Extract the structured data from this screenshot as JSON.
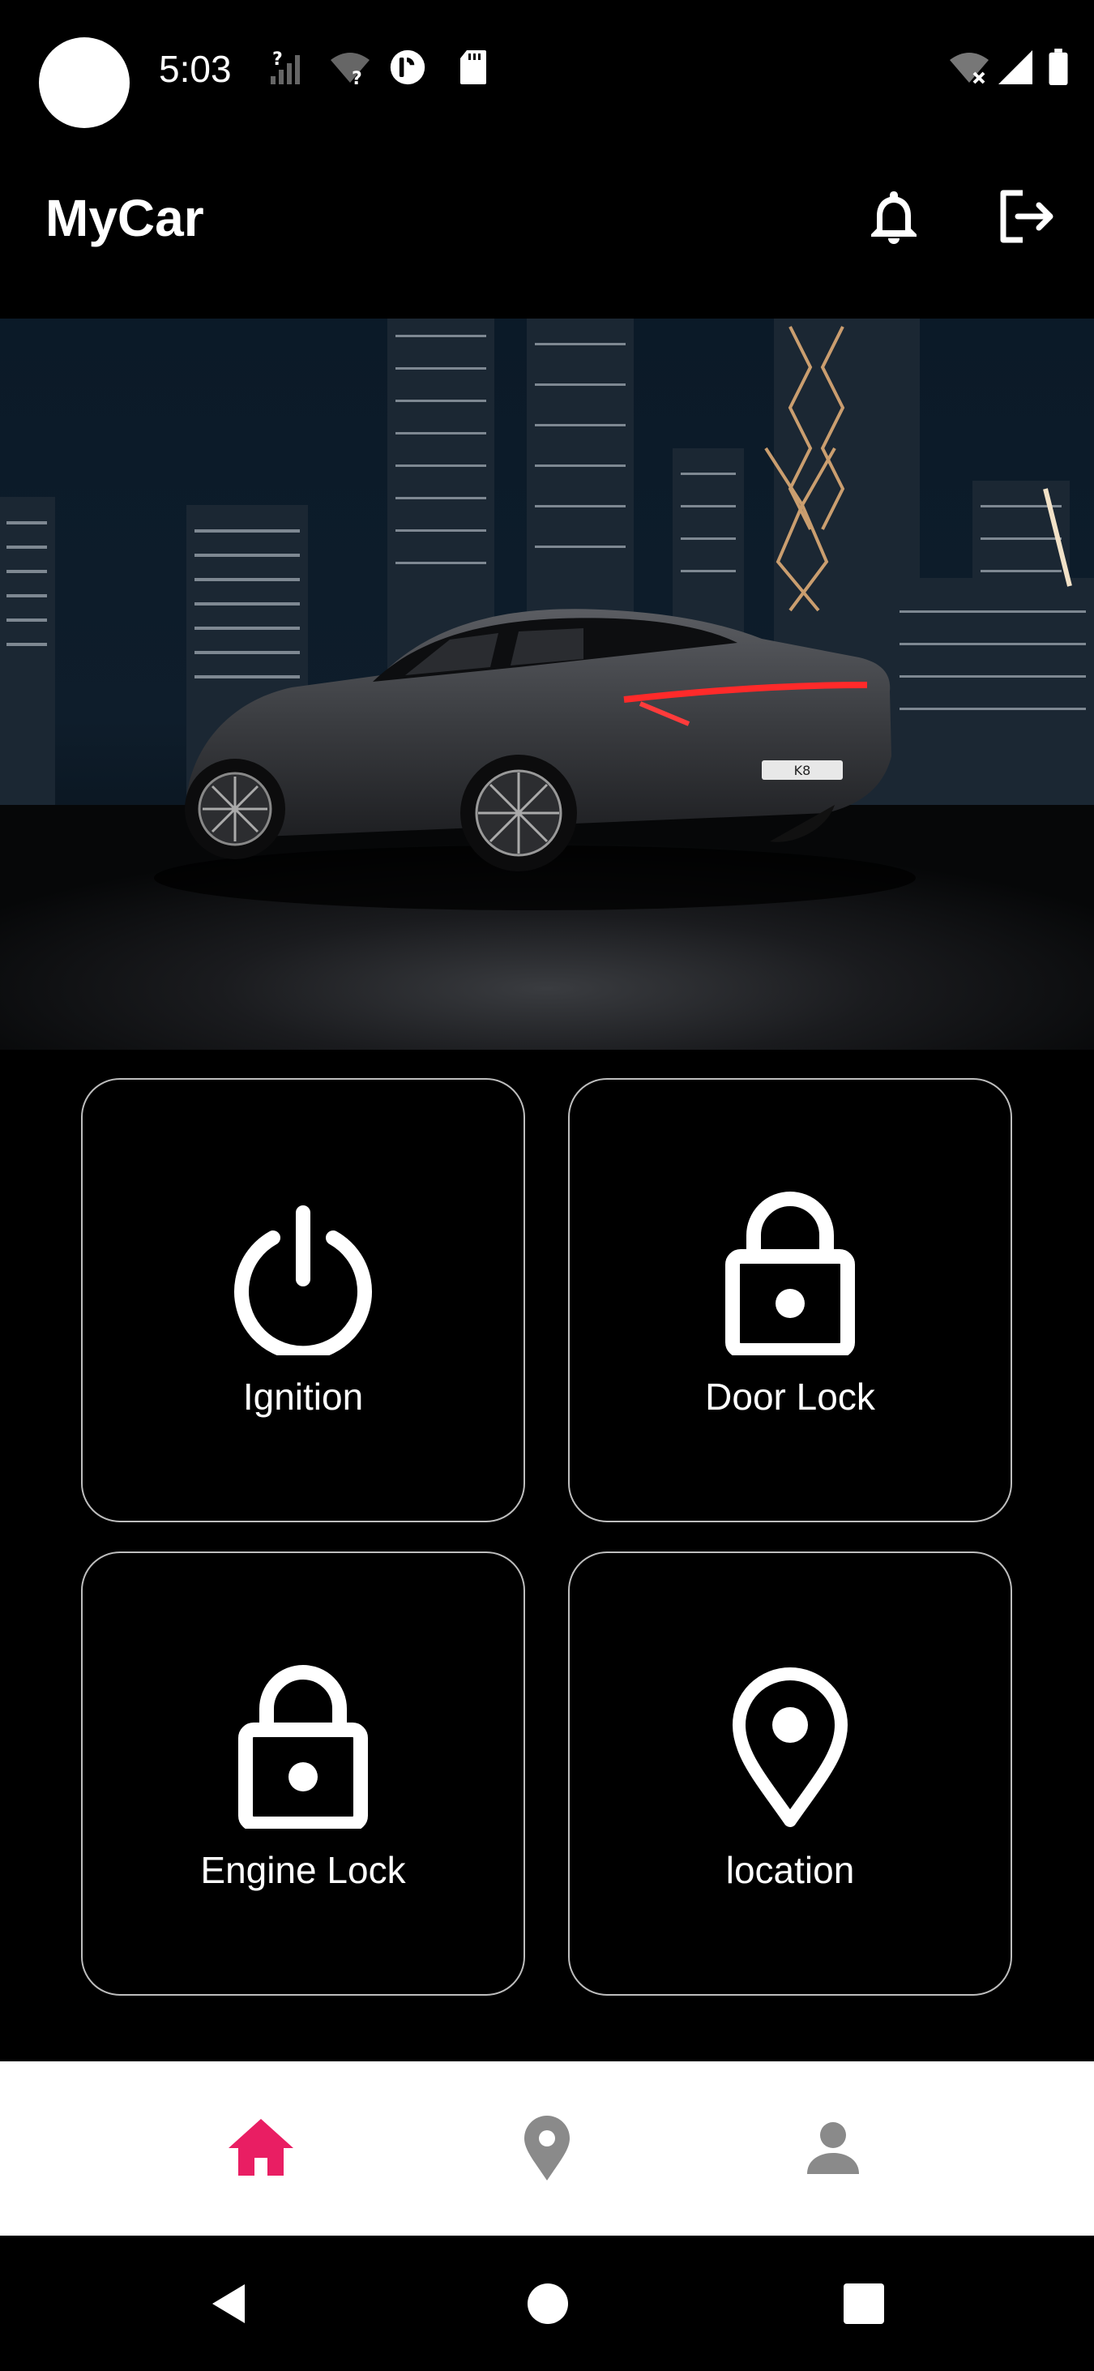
{
  "status_bar": {
    "time": "5:03",
    "icons": [
      "signal-unknown-icon",
      "wifi-unknown-icon",
      "pocket-casts-icon",
      "sd-card-icon",
      "wifi-off-icon",
      "cell-signal-icon",
      "battery-icon"
    ]
  },
  "app_bar": {
    "title": "MyCar",
    "actions": [
      "bell-icon",
      "logout-icon"
    ]
  },
  "hero": {
    "description_icon": "car-hero-image"
  },
  "tiles": [
    {
      "label": "Ignition",
      "icon": "power-icon"
    },
    {
      "label": "Door Lock",
      "icon": "lock-icon"
    },
    {
      "label": "Engine Lock",
      "icon": "lock-icon"
    },
    {
      "label": "location",
      "icon": "location-pin-icon"
    }
  ],
  "bottom_nav": {
    "items": [
      {
        "icon": "home-icon",
        "active": true
      },
      {
        "icon": "location-pin-icon",
        "active": false
      },
      {
        "icon": "person-icon",
        "active": false
      }
    ],
    "active_color": "#E91E63",
    "inactive_color": "#8a8a8a"
  },
  "system_nav": [
    "back-icon",
    "home-circle-icon",
    "recents-icon"
  ]
}
